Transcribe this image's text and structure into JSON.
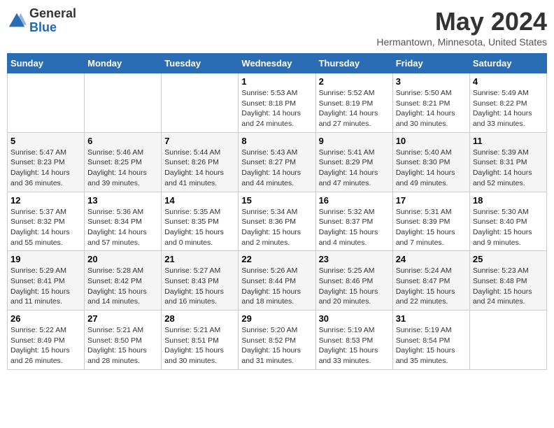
{
  "header": {
    "logo_general": "General",
    "logo_blue": "Blue",
    "month_title": "May 2024",
    "location": "Hermantown, Minnesota, United States"
  },
  "weekdays": [
    "Sunday",
    "Monday",
    "Tuesday",
    "Wednesday",
    "Thursday",
    "Friday",
    "Saturday"
  ],
  "weeks": [
    [
      {
        "day": "",
        "info": ""
      },
      {
        "day": "",
        "info": ""
      },
      {
        "day": "",
        "info": ""
      },
      {
        "day": "1",
        "info": "Sunrise: 5:53 AM\nSunset: 8:18 PM\nDaylight: 14 hours and 24 minutes."
      },
      {
        "day": "2",
        "info": "Sunrise: 5:52 AM\nSunset: 8:19 PM\nDaylight: 14 hours and 27 minutes."
      },
      {
        "day": "3",
        "info": "Sunrise: 5:50 AM\nSunset: 8:21 PM\nDaylight: 14 hours and 30 minutes."
      },
      {
        "day": "4",
        "info": "Sunrise: 5:49 AM\nSunset: 8:22 PM\nDaylight: 14 hours and 33 minutes."
      }
    ],
    [
      {
        "day": "5",
        "info": "Sunrise: 5:47 AM\nSunset: 8:23 PM\nDaylight: 14 hours and 36 minutes."
      },
      {
        "day": "6",
        "info": "Sunrise: 5:46 AM\nSunset: 8:25 PM\nDaylight: 14 hours and 39 minutes."
      },
      {
        "day": "7",
        "info": "Sunrise: 5:44 AM\nSunset: 8:26 PM\nDaylight: 14 hours and 41 minutes."
      },
      {
        "day": "8",
        "info": "Sunrise: 5:43 AM\nSunset: 8:27 PM\nDaylight: 14 hours and 44 minutes."
      },
      {
        "day": "9",
        "info": "Sunrise: 5:41 AM\nSunset: 8:29 PM\nDaylight: 14 hours and 47 minutes."
      },
      {
        "day": "10",
        "info": "Sunrise: 5:40 AM\nSunset: 8:30 PM\nDaylight: 14 hours and 49 minutes."
      },
      {
        "day": "11",
        "info": "Sunrise: 5:39 AM\nSunset: 8:31 PM\nDaylight: 14 hours and 52 minutes."
      }
    ],
    [
      {
        "day": "12",
        "info": "Sunrise: 5:37 AM\nSunset: 8:32 PM\nDaylight: 14 hours and 55 minutes."
      },
      {
        "day": "13",
        "info": "Sunrise: 5:36 AM\nSunset: 8:34 PM\nDaylight: 14 hours and 57 minutes."
      },
      {
        "day": "14",
        "info": "Sunrise: 5:35 AM\nSunset: 8:35 PM\nDaylight: 15 hours and 0 minutes."
      },
      {
        "day": "15",
        "info": "Sunrise: 5:34 AM\nSunset: 8:36 PM\nDaylight: 15 hours and 2 minutes."
      },
      {
        "day": "16",
        "info": "Sunrise: 5:32 AM\nSunset: 8:37 PM\nDaylight: 15 hours and 4 minutes."
      },
      {
        "day": "17",
        "info": "Sunrise: 5:31 AM\nSunset: 8:39 PM\nDaylight: 15 hours and 7 minutes."
      },
      {
        "day": "18",
        "info": "Sunrise: 5:30 AM\nSunset: 8:40 PM\nDaylight: 15 hours and 9 minutes."
      }
    ],
    [
      {
        "day": "19",
        "info": "Sunrise: 5:29 AM\nSunset: 8:41 PM\nDaylight: 15 hours and 11 minutes."
      },
      {
        "day": "20",
        "info": "Sunrise: 5:28 AM\nSunset: 8:42 PM\nDaylight: 15 hours and 14 minutes."
      },
      {
        "day": "21",
        "info": "Sunrise: 5:27 AM\nSunset: 8:43 PM\nDaylight: 15 hours and 16 minutes."
      },
      {
        "day": "22",
        "info": "Sunrise: 5:26 AM\nSunset: 8:44 PM\nDaylight: 15 hours and 18 minutes."
      },
      {
        "day": "23",
        "info": "Sunrise: 5:25 AM\nSunset: 8:46 PM\nDaylight: 15 hours and 20 minutes."
      },
      {
        "day": "24",
        "info": "Sunrise: 5:24 AM\nSunset: 8:47 PM\nDaylight: 15 hours and 22 minutes."
      },
      {
        "day": "25",
        "info": "Sunrise: 5:23 AM\nSunset: 8:48 PM\nDaylight: 15 hours and 24 minutes."
      }
    ],
    [
      {
        "day": "26",
        "info": "Sunrise: 5:22 AM\nSunset: 8:49 PM\nDaylight: 15 hours and 26 minutes."
      },
      {
        "day": "27",
        "info": "Sunrise: 5:21 AM\nSunset: 8:50 PM\nDaylight: 15 hours and 28 minutes."
      },
      {
        "day": "28",
        "info": "Sunrise: 5:21 AM\nSunset: 8:51 PM\nDaylight: 15 hours and 30 minutes."
      },
      {
        "day": "29",
        "info": "Sunrise: 5:20 AM\nSunset: 8:52 PM\nDaylight: 15 hours and 31 minutes."
      },
      {
        "day": "30",
        "info": "Sunrise: 5:19 AM\nSunset: 8:53 PM\nDaylight: 15 hours and 33 minutes."
      },
      {
        "day": "31",
        "info": "Sunrise: 5:19 AM\nSunset: 8:54 PM\nDaylight: 15 hours and 35 minutes."
      },
      {
        "day": "",
        "info": ""
      }
    ]
  ]
}
